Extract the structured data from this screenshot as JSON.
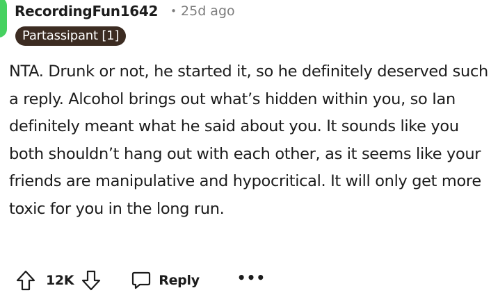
{
  "comment": {
    "author": "RecordingFun1642",
    "separator": "•",
    "age": "25d ago",
    "flair": "Partassipant [1]",
    "body": "NTA. Drunk or not, he started it, so he definitely deserved such a reply. Alcohol brings out what’s hidden within you, so Ian definitely meant what he said about you. It sounds like you both shouldn’t hang out with each other, as it seems like your friends are manipulative and hypocritical. It will only get more toxic for you in the long run."
  },
  "actions": {
    "score": "12K",
    "reply_label": "Reply",
    "more_label": "•••",
    "upvote_icon": "upvote-arrow-icon",
    "downvote_icon": "downvote-arrow-icon",
    "reply_icon": "speech-bubble-icon"
  },
  "colors": {
    "flair_bg": "#3c2c22",
    "avatar": "#46d160",
    "meta_text": "#7c7c7c"
  }
}
